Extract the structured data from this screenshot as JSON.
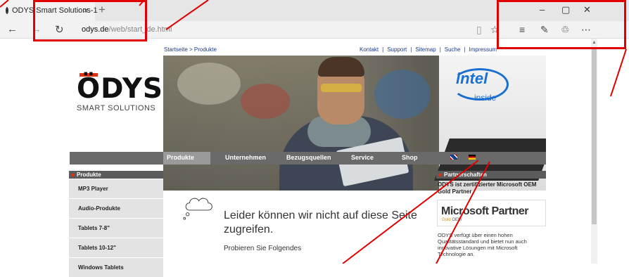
{
  "browser": {
    "tab": {
      "title": "ODYS Smart Solutions-1",
      "close": "×"
    },
    "new_tab": "+",
    "window": {
      "minimize": "–",
      "restore": "▢",
      "close": "✕"
    },
    "nav": {
      "back": "←",
      "forward": "→",
      "refresh": "↻"
    },
    "url": {
      "host": "odys.de",
      "path": "/web/start_de.html"
    },
    "right_icons": {
      "reading": "▯",
      "favorite": "☆",
      "hub": "≡",
      "note": "✎",
      "share": "♲",
      "more": "⋯"
    }
  },
  "site": {
    "breadcrumb": "Startseite > Produkte",
    "top_links": [
      "Kontakt",
      "Support",
      "Sitemap",
      "Suche",
      "Impressum"
    ],
    "top_sep": "|",
    "logo": {
      "word": "ÖDYS",
      "sub": "SMART SOLUTIONS"
    },
    "banner": {
      "intel_word": "intel",
      "intel_inside": "inside"
    },
    "menu": [
      "Produkte",
      "Unternehmen",
      "Bezugsquellen",
      "Service",
      "Shop"
    ],
    "sidebar": {
      "heading": "Produkte",
      "items": [
        "MP3 Player",
        "Audio-Produkte",
        "Tablets 7-8\"",
        "Tablets 10-12\"",
        "Windows Tablets"
      ]
    },
    "error": {
      "title": "Leider können wir nicht auf diese Seite zugreifen.",
      "sub": "Probieren Sie Folgendes"
    },
    "partner": {
      "heading": "Partnerschaften",
      "bold": "ODYS ist zertifizierter Microsoft OEM Gold Partner",
      "ms_name": "Microsoft Partner",
      "ms_tier": "Gold",
      "ms_oem": "OEM",
      "desc": "ODYS verfügt über einen hohen Qualitätsstandard und bietet nun auch innovative Lösungen mit Microsoft Technologie an."
    }
  },
  "colors": {
    "annotation": "#e00000",
    "menu_bg": "#6a6a6a",
    "accent": "#e03010"
  }
}
